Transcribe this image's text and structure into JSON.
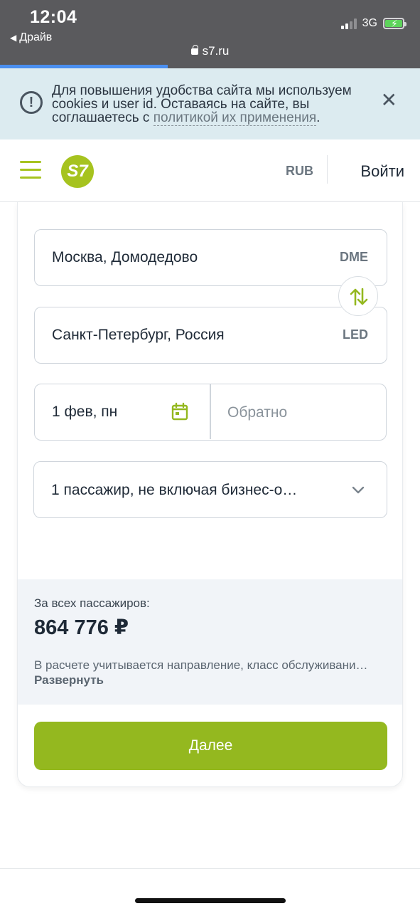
{
  "status_bar": {
    "time": "12:04",
    "back_app": "Драйв",
    "network": "3G",
    "battery_level": 1.0
  },
  "browser": {
    "url": "s7.ru",
    "load_progress": 0.4
  },
  "cookie_banner": {
    "text": "Для повышения удобства сайта мы используем cookies и user id. Оставаясь на сайте, вы соглашаетесь с ",
    "link": "политикой их применения",
    "suffix": "."
  },
  "header": {
    "logo": "S7",
    "currency": "RUB",
    "login": "Войти"
  },
  "form": {
    "from_city": "Москва, Домодедово",
    "from_code": "DME",
    "to_city": "Санкт-Петербург, Россия",
    "to_code": "LED",
    "depart_date": "1 фев, пн",
    "return_placeholder": "Обратно",
    "passengers": "1 пассажир, не включая бизнес-о…"
  },
  "totals": {
    "label": "За всех пассажиров:",
    "value": "864 776 ₽",
    "note": "В расчете учитывается направление, класс обслуживани…",
    "expand": "Развернуть"
  },
  "actions": {
    "next": "Далее"
  },
  "colors": {
    "brand": "#a6c31f",
    "button": "#94b81f",
    "banner": "#dcebf0"
  }
}
